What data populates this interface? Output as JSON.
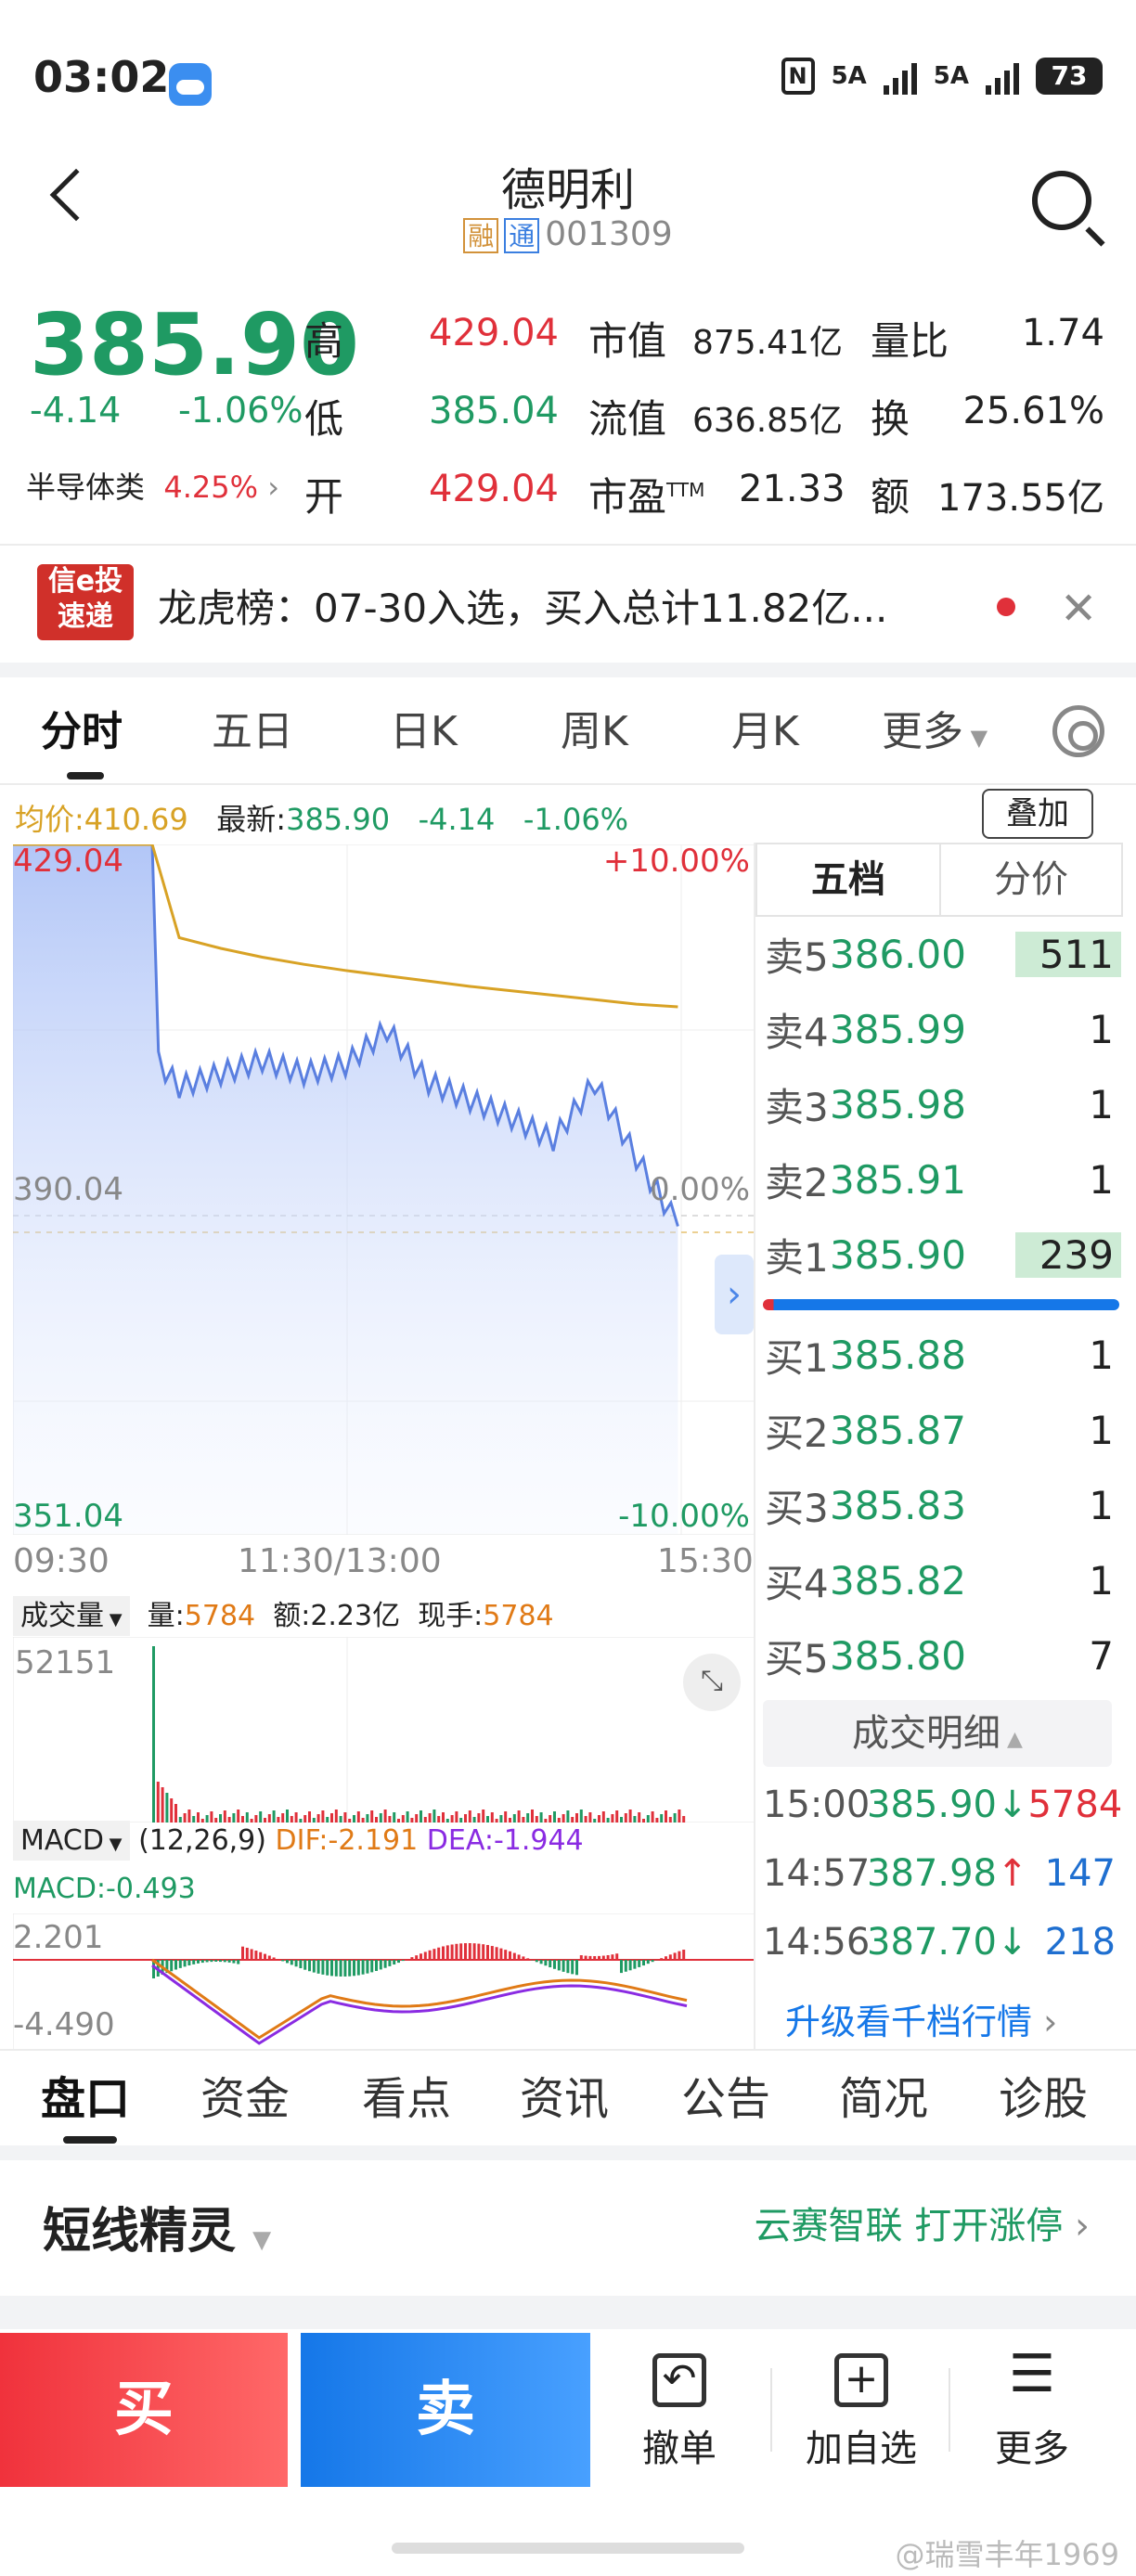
{
  "status": {
    "time": "03:02",
    "battery": "73",
    "sig1": "5A",
    "sig2": "5A",
    "nfc": "N"
  },
  "header": {
    "title": "德明利",
    "tag1": "融",
    "tag2": "通",
    "code": "001309"
  },
  "quote": {
    "price": "385.90",
    "change": "-4.14",
    "change_pct": "-1.06%",
    "sector": "半导体类",
    "sector_pct": "4.25%",
    "high_label": "高",
    "high": "429.04",
    "low_label": "低",
    "low": "385.04",
    "open_label": "开",
    "open": "429.04",
    "mktcap_label": "市值",
    "mktcap": "875.41亿",
    "float_label": "流值",
    "float": "636.85亿",
    "pe_label": "市盈",
    "pe_sup": "TTM",
    "pe": "21.33",
    "volratio_label": "量比",
    "volratio": "1.74",
    "turnover_label": "换",
    "turnover": "25.61%",
    "amount_label": "额",
    "amount": "173.55亿"
  },
  "banner": {
    "logo_line1": "信e投",
    "logo_line2": "速递",
    "text": "龙虎榜：07-30入选，买入总计11.82亿..."
  },
  "tabs": {
    "t1": "分时",
    "t2": "五日",
    "t3": "日K",
    "t4": "周K",
    "t5": "月K",
    "more": "更多"
  },
  "info": {
    "avg_label": "均价:",
    "avg": "410.69",
    "last_label": "最新:",
    "last": "385.90",
    "chg": "-4.14",
    "pct": "-1.06%",
    "overlay": "叠加"
  },
  "chart": {
    "top_price": "429.04",
    "mid_price": "390.04",
    "bottom_price": "351.04",
    "top_pct": "+10.00%",
    "mid_pct": "0.00%",
    "bottom_pct": "-10.00%",
    "t_start": "09:30",
    "t_mid": "11:30/13:00",
    "t_end": "15:30"
  },
  "chart_data": {
    "type": "line",
    "title": "",
    "xlabel": "",
    "ylabel": "",
    "ylim": [
      351.04,
      429.04
    ],
    "x": [
      "09:30",
      "09:45",
      "10:00",
      "10:15",
      "10:30",
      "10:45",
      "11:00",
      "11:15",
      "11:30",
      "13:15",
      "13:30",
      "13:45",
      "14:00",
      "14:15",
      "14:30",
      "14:45",
      "15:00"
    ],
    "series": [
      {
        "values": [
          429.04,
          412.5,
          402.0,
          407.0,
          401.5,
          403.0,
          404.5,
          403.0,
          404.0,
          408.0,
          402.0,
          400.0,
          398.0,
          395.5,
          402.0,
          393.5,
          385.9
        ]
      },
      {
        "values": [
          429.04,
          424.0,
          421.5,
          419.8,
          418.5,
          417.3,
          416.3,
          415.5,
          414.8,
          414.2,
          413.6,
          413.0,
          412.5,
          412.0,
          411.5,
          411.0,
          410.69
        ]
      }
    ]
  },
  "orderbook": {
    "head1": "五档",
    "head2": "分价",
    "asks": [
      {
        "name": "卖5",
        "price": "386.00",
        "vol": "511"
      },
      {
        "name": "卖4",
        "price": "385.99",
        "vol": "1"
      },
      {
        "name": "卖3",
        "price": "385.98",
        "vol": "1"
      },
      {
        "name": "卖2",
        "price": "385.91",
        "vol": "1"
      },
      {
        "name": "卖1",
        "price": "385.90",
        "vol": "239"
      }
    ],
    "bids": [
      {
        "name": "买1",
        "price": "385.88",
        "vol": "1"
      },
      {
        "name": "买2",
        "price": "385.87",
        "vol": "1"
      },
      {
        "name": "买3",
        "price": "385.83",
        "vol": "1"
      },
      {
        "name": "买4",
        "price": "385.82",
        "vol": "1"
      },
      {
        "name": "买5",
        "price": "385.80",
        "vol": "7"
      }
    ],
    "detail_label": "成交明细",
    "trades": [
      {
        "time": "15:00",
        "price": "385.90↓",
        "vol": "5784"
      },
      {
        "time": "14:57",
        "price": "387.98↑",
        "vol": "147"
      },
      {
        "time": "14:56",
        "price": "387.70↓",
        "vol": "218"
      }
    ],
    "upgrade": "升级看千档行情"
  },
  "volume": {
    "label": "成交量",
    "q_label": "量:",
    "q": "5784",
    "amt_label": "额:",
    "amt": "2.23亿",
    "hand_label": "现手:",
    "hand": "5784",
    "max": "52151"
  },
  "macd": {
    "label": "MACD",
    "params": "(12,26,9)",
    "dif": "DIF:-2.191",
    "dea": "DEA:-1.944",
    "macd": "MACD:-0.493",
    "top": "2.201",
    "bottom": "-4.490"
  },
  "bottom_tabs": {
    "b1": "盘口",
    "b2": "资金",
    "b3": "看点",
    "b4": "资讯",
    "b5": "公告",
    "b6": "简况",
    "b7": "诊股"
  },
  "spirit": {
    "title": "短线精灵",
    "right": "云赛智联 打开涨停"
  },
  "actions": {
    "buy": "买",
    "sell": "卖",
    "cancel": "撤单",
    "watch": "加自选",
    "more": "更多"
  },
  "watermark": "@瑞雪丰年1969",
  "colors": {
    "up": "#e0303a",
    "down": "#1f9a63",
    "accent": "#1577e8",
    "avg_line": "#d8a225"
  }
}
